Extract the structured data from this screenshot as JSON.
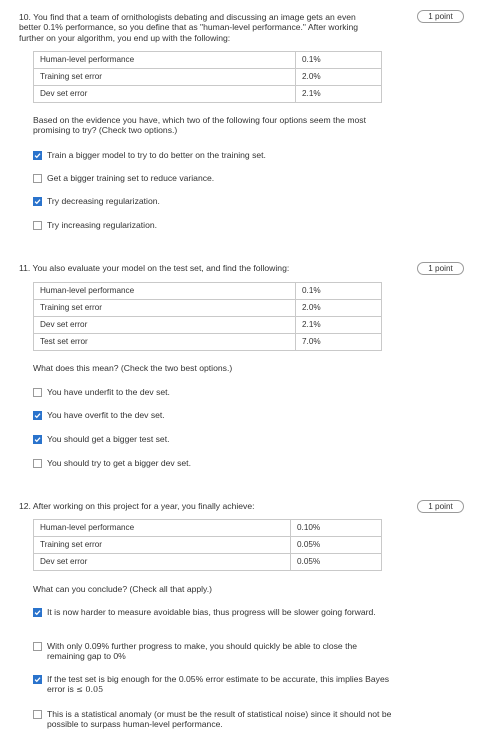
{
  "questions": [
    {
      "title": "10. You find that a team of ornithologists debating and discussing an image gets an even better 0.1% performance, so you define that as \"human-level performance.\" After working further on your algorithm, you end up with the following:",
      "points": "1 point",
      "table": [
        {
          "label": "Human-level performance",
          "value": "0.1%"
        },
        {
          "label": "Training set error",
          "value": "2.0%"
        },
        {
          "label": "Dev set error",
          "value": "2.1%"
        }
      ],
      "prompt": "Based on the evidence you have, which two of the following four options seem the most promising to try? (Check two options.)",
      "options": [
        {
          "text": "Train a bigger model to try to do better on the training set.",
          "checked": true
        },
        {
          "text": "Get a bigger training set to reduce variance.",
          "checked": false
        },
        {
          "text": "Try decreasing regularization.",
          "checked": true
        },
        {
          "text": "Try increasing regularization.",
          "checked": false
        }
      ]
    },
    {
      "title": "11. You also evaluate your model on the test set, and find the following:",
      "points": "1 point",
      "table": [
        {
          "label": "Human-level performance",
          "value": "0.1%"
        },
        {
          "label": "Training set error",
          "value": "2.0%"
        },
        {
          "label": "Dev set error",
          "value": "2.1%"
        },
        {
          "label": "Test set error",
          "value": "7.0%"
        }
      ],
      "prompt": "What does this mean? (Check the two best options.)",
      "options": [
        {
          "text": "You have underfit to the dev set.",
          "checked": false
        },
        {
          "text": "You have overfit to the dev set.",
          "checked": true
        },
        {
          "text": "You should get a bigger test set.",
          "checked": true
        },
        {
          "text": "You should try to get a bigger dev set.",
          "checked": false
        }
      ]
    },
    {
      "title": "12. After working on this project for a year, you finally achieve:",
      "points": "1 point",
      "table": [
        {
          "label": "Human-level performance",
          "value": "0.10%"
        },
        {
          "label": "Training set error",
          "value": "0.05%"
        },
        {
          "label": "Dev set error",
          "value": "0.05%"
        }
      ],
      "prompt": "What can you conclude? (Check all that apply.)",
      "options": [
        {
          "text": "It is now harder to measure avoidable bias, thus progress will be slower going forward.",
          "checked": true
        },
        {
          "text": "With only 0.09% further progress to make, you should quickly be able to close the remaining gap to 0%",
          "checked": false
        },
        {
          "text": "If the test set is big enough for the 0.05% error estimate to be accurate, this implies Bayes error is",
          "math": "≤ 0.05",
          "checked": true
        },
        {
          "text": "This is a statistical anomaly (or must be the result of statistical noise) since it should not be possible to surpass human-level performance.",
          "checked": false
        }
      ]
    }
  ]
}
